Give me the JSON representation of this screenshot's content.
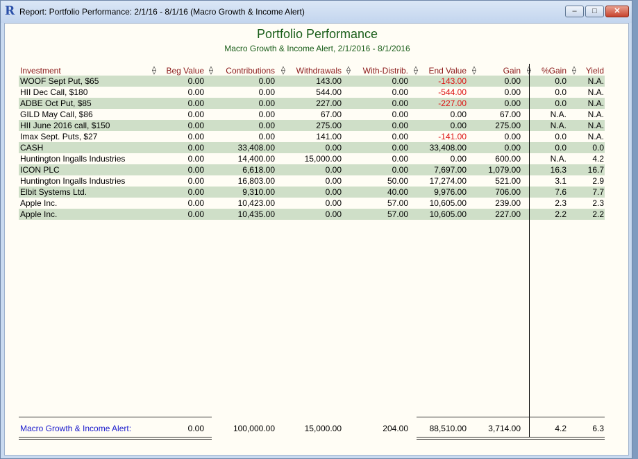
{
  "window": {
    "title": "Report: Portfolio Performance: 2/1/16 - 8/1/16 (Macro Growth & Income Alert)",
    "app_icon": "R",
    "minimize_glyph": "–",
    "maximize_glyph": "□",
    "close_glyph": "✕"
  },
  "report": {
    "title": "Portfolio Performance",
    "subtitle": "Macro Growth & Income Alert, 2/1/2016 - 8/1/2016",
    "headers": {
      "investment": "Investment",
      "beg_value": "Beg Value",
      "contributions": "Contributions",
      "withdrawals": "Withdrawals",
      "with_distrib": "With-Distrib.",
      "end_value": "End Value",
      "gain": "Gain",
      "pct_gain": "%Gain",
      "yield": "Yield"
    },
    "sep_glyph": "⟠",
    "rows": [
      {
        "investment": "WOOF Sept Put, $65",
        "beg": "0.00",
        "contrib": "0.00",
        "withdraw": "143.00",
        "distrib": "0.00",
        "end": "-143.00",
        "gain": "0.00",
        "pct": "0.0",
        "yield": "N.A."
      },
      {
        "investment": "HII Dec Call, $180",
        "beg": "0.00",
        "contrib": "0.00",
        "withdraw": "544.00",
        "distrib": "0.00",
        "end": "-544.00",
        "gain": "0.00",
        "pct": "0.0",
        "yield": "N.A."
      },
      {
        "investment": "ADBE Oct Put, $85",
        "beg": "0.00",
        "contrib": "0.00",
        "withdraw": "227.00",
        "distrib": "0.00",
        "end": "-227.00",
        "gain": "0.00",
        "pct": "0.0",
        "yield": "N.A."
      },
      {
        "investment": "GILD May Call, $86",
        "beg": "0.00",
        "contrib": "0.00",
        "withdraw": "67.00",
        "distrib": "0.00",
        "end": "0.00",
        "gain": "67.00",
        "pct": "N.A.",
        "yield": "N.A."
      },
      {
        "investment": "HII June 2016 call, $150",
        "beg": "0.00",
        "contrib": "0.00",
        "withdraw": "275.00",
        "distrib": "0.00",
        "end": "0.00",
        "gain": "275.00",
        "pct": "N.A.",
        "yield": "N.A."
      },
      {
        "investment": "Imax Sept. Puts, $27",
        "beg": "0.00",
        "contrib": "0.00",
        "withdraw": "141.00",
        "distrib": "0.00",
        "end": "-141.00",
        "gain": "0.00",
        "pct": "0.0",
        "yield": "N.A."
      },
      {
        "investment": "CASH",
        "beg": "0.00",
        "contrib": "33,408.00",
        "withdraw": "0.00",
        "distrib": "0.00",
        "end": "33,408.00",
        "gain": "0.00",
        "pct": "0.0",
        "yield": "0.0"
      },
      {
        "investment": "Huntington Ingalls Industries",
        "beg": "0.00",
        "contrib": "14,400.00",
        "withdraw": "15,000.00",
        "distrib": "0.00",
        "end": "0.00",
        "gain": "600.00",
        "pct": "N.A.",
        "yield": "4.2"
      },
      {
        "investment": "ICON PLC",
        "beg": "0.00",
        "contrib": "6,618.00",
        "withdraw": "0.00",
        "distrib": "0.00",
        "end": "7,697.00",
        "gain": "1,079.00",
        "pct": "16.3",
        "yield": "16.7"
      },
      {
        "investment": "Huntington Ingalls Industries",
        "beg": "0.00",
        "contrib": "16,803.00",
        "withdraw": "0.00",
        "distrib": "50.00",
        "end": "17,274.00",
        "gain": "521.00",
        "pct": "3.1",
        "yield": "2.9"
      },
      {
        "investment": "Elbit Systems Ltd.",
        "beg": "0.00",
        "contrib": "9,310.00",
        "withdraw": "0.00",
        "distrib": "40.00",
        "end": "9,976.00",
        "gain": "706.00",
        "pct": "7.6",
        "yield": "7.7"
      },
      {
        "investment": "Apple Inc.",
        "beg": "0.00",
        "contrib": "10,423.00",
        "withdraw": "0.00",
        "distrib": "57.00",
        "end": "10,605.00",
        "gain": "239.00",
        "pct": "2.3",
        "yield": "2.3"
      },
      {
        "investment": "Apple Inc.",
        "beg": "0.00",
        "contrib": "10,435.00",
        "withdraw": "0.00",
        "distrib": "57.00",
        "end": "10,605.00",
        "gain": "227.00",
        "pct": "2.2",
        "yield": "2.2"
      }
    ],
    "totals": {
      "label": "Macro Growth & Income Alert:",
      "beg": "0.00",
      "contrib": "100,000.00",
      "withdraw": "15,000.00",
      "distrib": "204.00",
      "end": "88,510.00",
      "gain": "3,714.00",
      "pct": "4.2",
      "yield": "6.3"
    },
    "colors": {
      "band": "#cfdfc8",
      "header_text": "#8b1a1a",
      "title_text": "#1a5e1a",
      "negative": "#dd1111",
      "total_label": "#1a1acc"
    }
  }
}
